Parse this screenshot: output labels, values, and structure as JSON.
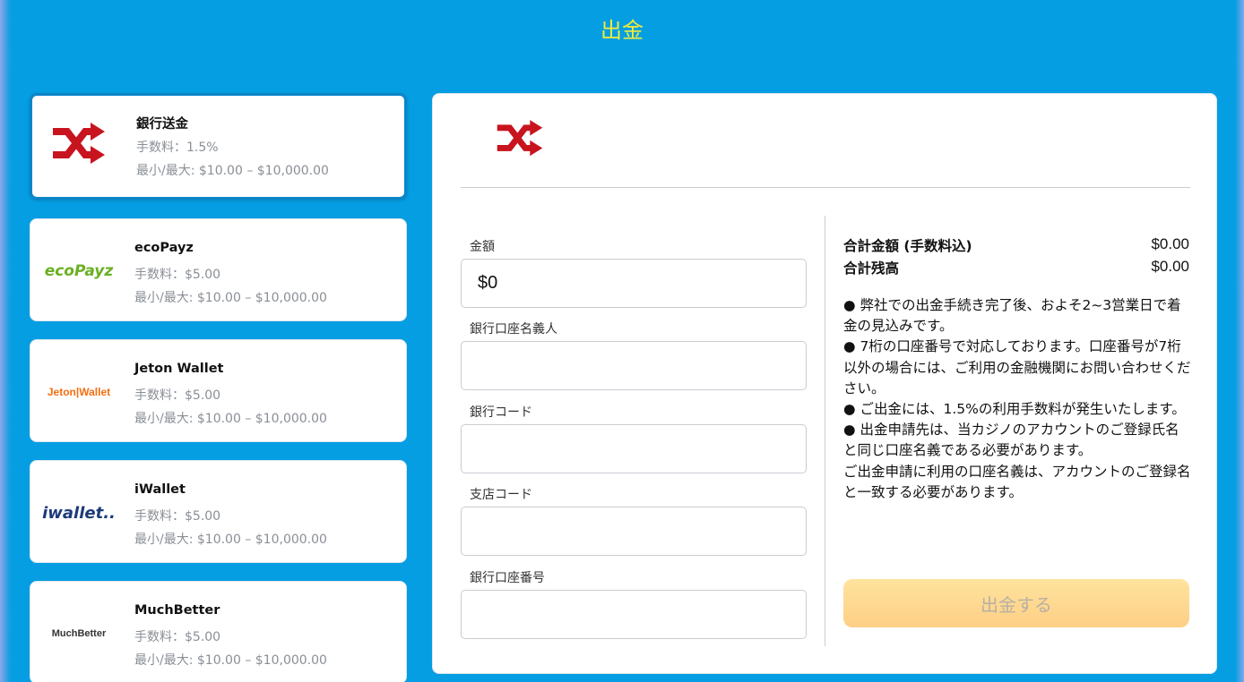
{
  "page": {
    "title": "出金"
  },
  "methods": [
    {
      "name": "銀行送金",
      "fee": "手数料：1.5%",
      "limit": "最小/最大: $10.00 – $10,000.00",
      "logo": "bank-transfer-shuffle-icon",
      "selected": true
    },
    {
      "name": "ecoPayz",
      "fee": "手数料：$5.00",
      "limit": "最小/最大: $10.00 – $10,000.00",
      "logo": "ecopayz-logo",
      "logo_text": "ecoPayz"
    },
    {
      "name": "Jeton Wallet",
      "fee": "手数料：$5.00",
      "limit": "最小/最大: $10.00 – $10,000.00",
      "logo": "jeton-logo",
      "logo_text": "Jeton|Wallet"
    },
    {
      "name": "iWallet",
      "fee": "手数料：$5.00",
      "limit": "最小/最大: $10.00 – $10,000.00",
      "logo": "iwallet-logo",
      "logo_text": "iwallet.."
    },
    {
      "name": "MuchBetter",
      "fee": "手数料：$5.00",
      "limit": "最小/最大: $10.00 – $10,000.00",
      "logo": "muchbetter-logo",
      "logo_text": "MuchBetter"
    }
  ],
  "form": {
    "amount": {
      "label": "金額",
      "value": "$0"
    },
    "account_name": {
      "label": "銀行口座名義人",
      "value": ""
    },
    "bank_code": {
      "label": "銀行コード",
      "value": ""
    },
    "branch_code": {
      "label": "支店コード",
      "value": ""
    },
    "account_number": {
      "label": "銀行口座番号",
      "value": ""
    }
  },
  "summary": {
    "total_label": "合計金額 (手数料込)",
    "total_value": "$0.00",
    "balance_label": "合計残高",
    "balance_value": "$0.00"
  },
  "notes": [
    "● 弊社での出金手続き完了後、およそ2~3営業日で着金の見込みです。",
    "● 7桁の口座番号で対応しております。口座番号が7桁以外の場合には、ご利用の金融機関にお問い合わせください。",
    "● ご出金には、1.5%の利用手数料が発生いたします。",
    "● 出金申請先は、当カジノのアカウントのご登録氏名と同じ口座名義である必要があります。",
    "ご出金申請に利用の口座名義は、アカウントのご登録名と一致する必要があります。"
  ],
  "submit_label": "出金する",
  "colors": {
    "background": "#059ee2",
    "title": "#f2ec3a",
    "accent_border": "#0b86c8",
    "button": "#fdd893",
    "bank_icon": "#c8141e"
  }
}
